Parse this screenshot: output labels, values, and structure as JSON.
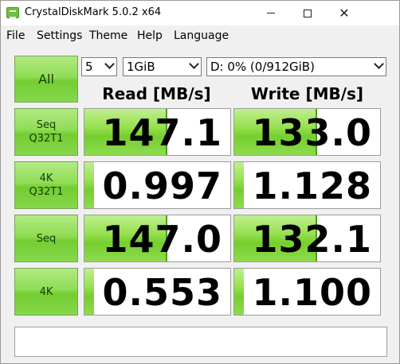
{
  "window": {
    "title": "CrystalDiskMark 5.0.2 x64",
    "minimize": "",
    "maximize": "",
    "close": "✕"
  },
  "menu": [
    "File",
    "Settings",
    "Theme",
    "Help",
    "Language"
  ],
  "controls": {
    "all_label": "All",
    "count": "5",
    "size": "1GiB",
    "drive": "D: 0% (0/912GiB)"
  },
  "headers": {
    "read": "Read [MB/s]",
    "write": "Write [MB/s]"
  },
  "rows": [
    {
      "label": "Seq\nQ32T1",
      "read": "147.1",
      "write": "133.0"
    },
    {
      "label": "4K\nQ32T1",
      "read": "0.997",
      "write": "1.128"
    },
    {
      "label": "Seq",
      "read": "147.0",
      "write": "132.1"
    },
    {
      "label": "4K",
      "read": "0.553",
      "write": "1.100"
    }
  ],
  "colors": {
    "accent_green": "#74cd32",
    "button_border": "#7aa25a"
  },
  "comment": ""
}
